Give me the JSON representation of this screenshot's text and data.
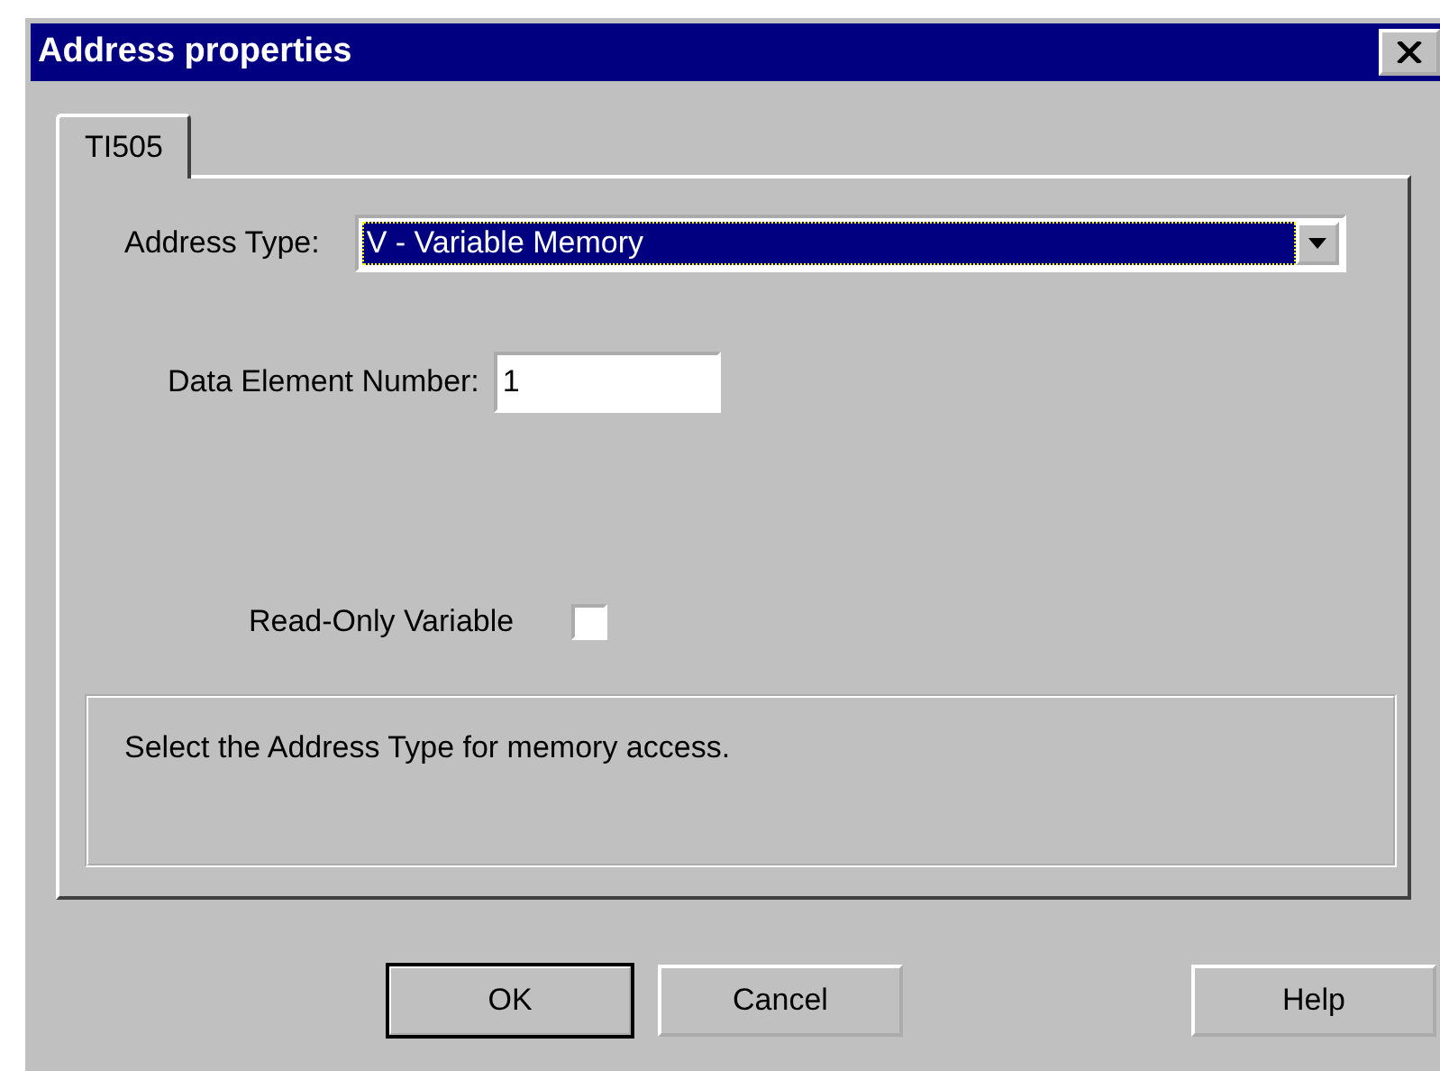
{
  "window": {
    "title": "Address properties"
  },
  "tabs": [
    {
      "label": "TI505",
      "selected": true
    }
  ],
  "address_type": {
    "label": "Address Type:",
    "value": "V - Variable Memory"
  },
  "data_element_number": {
    "label": "Data Element Number:",
    "value": "1"
  },
  "read_only": {
    "label": "Read-Only Variable",
    "checked": false
  },
  "description": "Select the Address Type for memory access.",
  "buttons": [
    {
      "label": "OK",
      "default": true
    },
    {
      "label": "Cancel",
      "default": false
    },
    {
      "label": "Help",
      "default": false
    }
  ]
}
